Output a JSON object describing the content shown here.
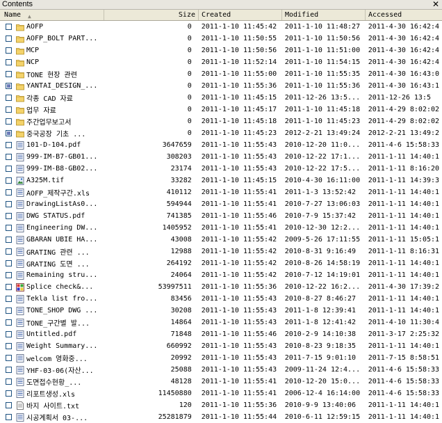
{
  "window": {
    "title": "Contents",
    "close_glyph": "✕"
  },
  "columns": {
    "name": "Name",
    "size": "Size",
    "created": "Created",
    "modified": "Modified",
    "accessed": "Accessed"
  },
  "rows": [
    {
      "name": "AOFP",
      "size": "0",
      "created": "2011-1-10 11:45:42",
      "modified": "2011-1-10 11:48:27",
      "accessed": "2011-4-30 16:42:4",
      "type": "folder",
      "checked": false
    },
    {
      "name": "AOFP_BOLT PART...",
      "size": "0",
      "created": "2011-1-10 11:50:55",
      "modified": "2011-1-10 11:50:56",
      "accessed": "2011-4-30 16:42:4",
      "type": "folder",
      "checked": false
    },
    {
      "name": "MCP",
      "size": "0",
      "created": "2011-1-10 11:50:56",
      "modified": "2011-1-10 11:51:00",
      "accessed": "2011-4-30 16:42:4",
      "type": "folder",
      "checked": false
    },
    {
      "name": "NCP",
      "size": "0",
      "created": "2011-1-10 11:52:14",
      "modified": "2011-1-10 11:54:15",
      "accessed": "2011-4-30 16:42:4",
      "type": "folder",
      "checked": false
    },
    {
      "name": "TONE 현장 관련",
      "size": "0",
      "created": "2011-1-10 11:55:00",
      "modified": "2011-1-10 11:55:35",
      "accessed": "2011-4-30 16:43:0",
      "type": "folder",
      "checked": false
    },
    {
      "name": "YANTAI_DESIGN_...",
      "size": "0",
      "created": "2011-1-10 11:55:36",
      "modified": "2011-1-10 11:55:36",
      "accessed": "2011-4-30 16:43:1",
      "type": "folder",
      "checked": true
    },
    {
      "name": "각종 CAD 자료",
      "size": "0",
      "created": "2011-1-10 11:45:15",
      "modified": "2011-12-26 13:5...",
      "accessed": "2011-12-26 13:5",
      "type": "folder",
      "checked": false
    },
    {
      "name": "업무 자료",
      "size": "0",
      "created": "2011-1-10 11:45:17",
      "modified": "2011-1-10 11:45:18",
      "accessed": "2011-4-29 8:02:02",
      "type": "folder",
      "checked": false
    },
    {
      "name": "주간업무보고서",
      "size": "0",
      "created": "2011-1-10 11:45:18",
      "modified": "2011-1-10 11:45:23",
      "accessed": "2011-4-29 8:02:02",
      "type": "folder",
      "checked": false
    },
    {
      "name": "중국공장 기초 ...",
      "size": "0",
      "created": "2011-1-10 11:45:23",
      "modified": "2012-2-21 13:49:24",
      "accessed": "2012-2-21 13:49:2",
      "type": "folder",
      "checked": true
    },
    {
      "name": "101-D-104.pdf",
      "size": "3647659",
      "created": "2011-1-10 11:55:43",
      "modified": "2010-12-20 11:0...",
      "accessed": "2011-4-6 15:58:33",
      "type": "pdf",
      "checked": false
    },
    {
      "name": "999-IM-B7-GB01...",
      "size": "308203",
      "created": "2011-1-10 11:55:43",
      "modified": "2010-12-22 17:1...",
      "accessed": "2011-1-11 14:40:1",
      "type": "pdf",
      "checked": false
    },
    {
      "name": "999-IM-B8-GB02...",
      "size": "23174",
      "created": "2011-1-10 11:55:43",
      "modified": "2010-12-22 17:5...",
      "accessed": "2011-1-11 8:16:20",
      "type": "pdf",
      "checked": false
    },
    {
      "name": "A325M.tif",
      "size": "33282",
      "created": "2011-1-10 11:45:15",
      "modified": "2010-4-30 16:11:00",
      "accessed": "2011-1-11 14:39:3",
      "type": "image",
      "checked": false
    },
    {
      "name": "AOFP_제작구간.xls",
      "size": "410112",
      "created": "2011-1-10 11:55:41",
      "modified": "2011-1-3 13:52:42",
      "accessed": "2011-1-11 14:40:1",
      "type": "xls",
      "checked": false
    },
    {
      "name": "DrawingListAs0...",
      "size": "594944",
      "created": "2011-1-10 11:55:41",
      "modified": "2010-7-27 13:06:03",
      "accessed": "2011-1-11 14:40:1",
      "type": "xls",
      "checked": false
    },
    {
      "name": "DWG STATUS.pdf",
      "size": "741385",
      "created": "2011-1-10 11:55:46",
      "modified": "2010-7-9 15:37:42",
      "accessed": "2011-1-11 14:40:1",
      "type": "pdf",
      "checked": false
    },
    {
      "name": "Engineering DW...",
      "size": "1405952",
      "created": "2011-1-10 11:55:41",
      "modified": "2010-12-30 12:2...",
      "accessed": "2011-1-11 14:40:1",
      "type": "xls",
      "checked": false
    },
    {
      "name": "GBARAN UBIE HA...",
      "size": "43008",
      "created": "2011-1-10 11:55:42",
      "modified": "2009-5-26 17:11:55",
      "accessed": "2011-1-11 15:05:1",
      "type": "xls",
      "checked": false
    },
    {
      "name": "GRATING 관련 ...",
      "size": "12988",
      "created": "2011-1-10 11:55:42",
      "modified": "2010-8-31 9:16:49",
      "accessed": "2011-1-11 8:16:31",
      "type": "pdf",
      "checked": false
    },
    {
      "name": "GRATING 도면 ...",
      "size": "264192",
      "created": "2011-1-10 11:55:42",
      "modified": "2010-8-26 14:58:19",
      "accessed": "2011-1-11 14:40:1",
      "type": "xls",
      "checked": false
    },
    {
      "name": "Remaining stru...",
      "size": "24064",
      "created": "2011-1-10 11:55:42",
      "modified": "2010-7-12 14:19:01",
      "accessed": "2011-1-11 14:40:1",
      "type": "xls",
      "checked": false
    },
    {
      "name": "Splice check&...",
      "size": "53997511",
      "created": "2011-1-10 11:55:36",
      "modified": "2010-12-22 16:2...",
      "accessed": "2011-4-30 17:39:2",
      "type": "special",
      "checked": false
    },
    {
      "name": "Tekla list fro...",
      "size": "83456",
      "created": "2011-1-10 11:55:43",
      "modified": "2010-8-27 8:46:27",
      "accessed": "2011-1-11 14:40:1",
      "type": "xls",
      "checked": false
    },
    {
      "name": "TONE_SHOP DWG ...",
      "size": "30208",
      "created": "2011-1-10 11:55:43",
      "modified": "2011-1-8 12:39:41",
      "accessed": "2011-1-11 14:40:1",
      "type": "xls",
      "checked": false
    },
    {
      "name": "TONE_구간별 발...",
      "size": "14864",
      "created": "2011-1-10 11:55:43",
      "modified": "2011-1-8 12:41:42",
      "accessed": "2011-4-10 11:30:4",
      "type": "xls",
      "checked": false
    },
    {
      "name": "Untitled.pdf",
      "size": "71848",
      "created": "2011-1-10 11:55:46",
      "modified": "2010-2-9 14:10:38",
      "accessed": "2011-3-17 2:25:32",
      "type": "pdf",
      "checked": false
    },
    {
      "name": "Weight Summary...",
      "size": "660992",
      "created": "2011-1-10 11:55:43",
      "modified": "2010-8-23 9:18:35",
      "accessed": "2011-1-11 14:40:1",
      "type": "xls",
      "checked": false
    },
    {
      "name": "welcom 영화중...",
      "size": "20992",
      "created": "2011-1-10 11:55:43",
      "modified": "2011-7-15 9:01:10",
      "accessed": "2011-7-15 8:58:51",
      "type": "xls",
      "checked": false
    },
    {
      "name": "YHF-03-06(자산...",
      "size": "25088",
      "created": "2011-1-10 11:55:43",
      "modified": "2009-11-24 12:4...",
      "accessed": "2011-4-6 15:58:33",
      "type": "xls",
      "checked": false
    },
    {
      "name": "도면접수현황_...",
      "size": "48128",
      "created": "2011-1-10 11:55:41",
      "modified": "2010-12-20 15:0...",
      "accessed": "2011-4-6 15:58:33",
      "type": "xls",
      "checked": false
    },
    {
      "name": "리포트생성.xls",
      "size": "11450880",
      "created": "2011-1-10 11:55:41",
      "modified": "2006-12-4 16:14:00",
      "accessed": "2011-4-6 15:58:33",
      "type": "xls",
      "checked": false
    },
    {
      "name": "바지 사이트.txt",
      "size": "120",
      "created": "2011-1-10 11:55:36",
      "modified": "2010-9-9 13:40:06",
      "accessed": "2011-1-11 14:40:1",
      "type": "txt",
      "checked": false
    },
    {
      "name": "시공계획서 03-...",
      "size": "25281879",
      "created": "2011-1-10 11:55:44",
      "modified": "2010-6-11 12:59:15",
      "accessed": "2011-1-11 14:40:1",
      "type": "xls",
      "checked": false
    }
  ]
}
